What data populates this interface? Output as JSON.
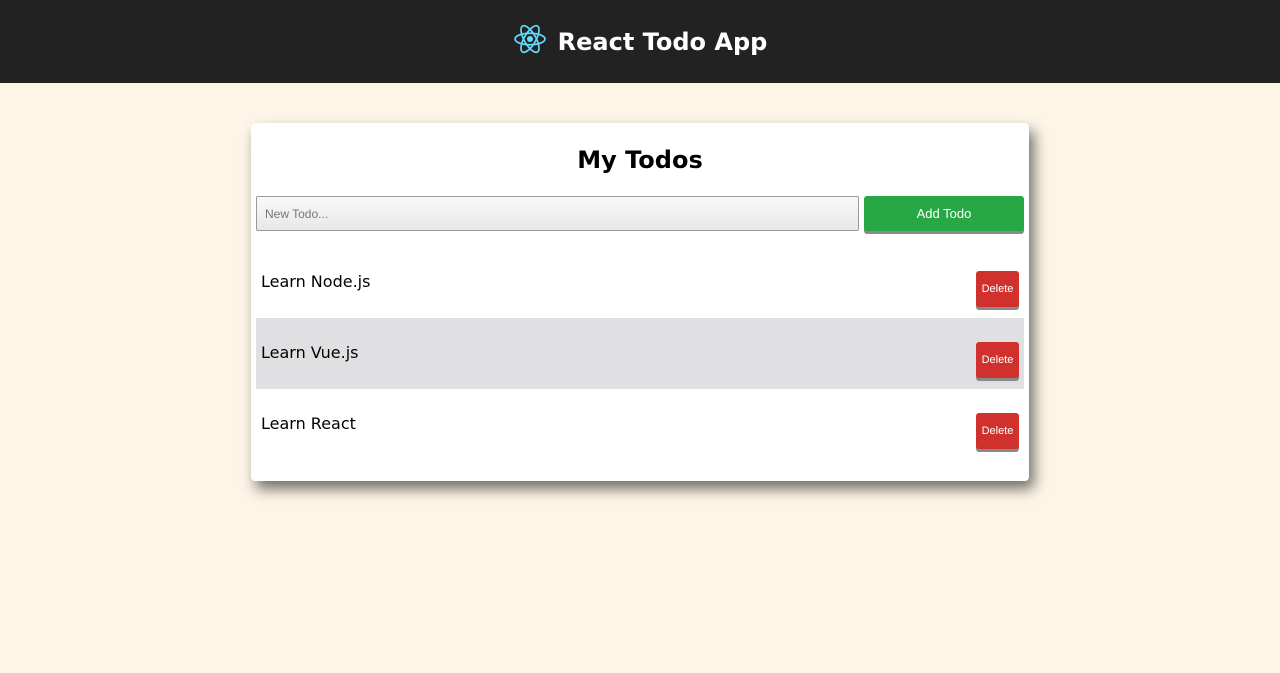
{
  "header": {
    "title": "React Todo App",
    "logo_icon": "react-logo-icon",
    "logo_color": "#61dafb"
  },
  "card": {
    "title": "My Todos"
  },
  "new_todo": {
    "placeholder": "New Todo...",
    "value": ""
  },
  "add_button": {
    "label": "Add Todo",
    "color": "#28a745"
  },
  "todos": [
    {
      "text": "Learn Node.js",
      "delete_label": "Delete"
    },
    {
      "text": "Learn Vue.js",
      "delete_label": "Delete"
    },
    {
      "text": "Learn React",
      "delete_label": "Delete"
    }
  ],
  "colors": {
    "page_background": "#fdf5e6",
    "header_background": "#222222",
    "delete_button": "#d0312d",
    "alt_row": "#e0e0e2"
  }
}
